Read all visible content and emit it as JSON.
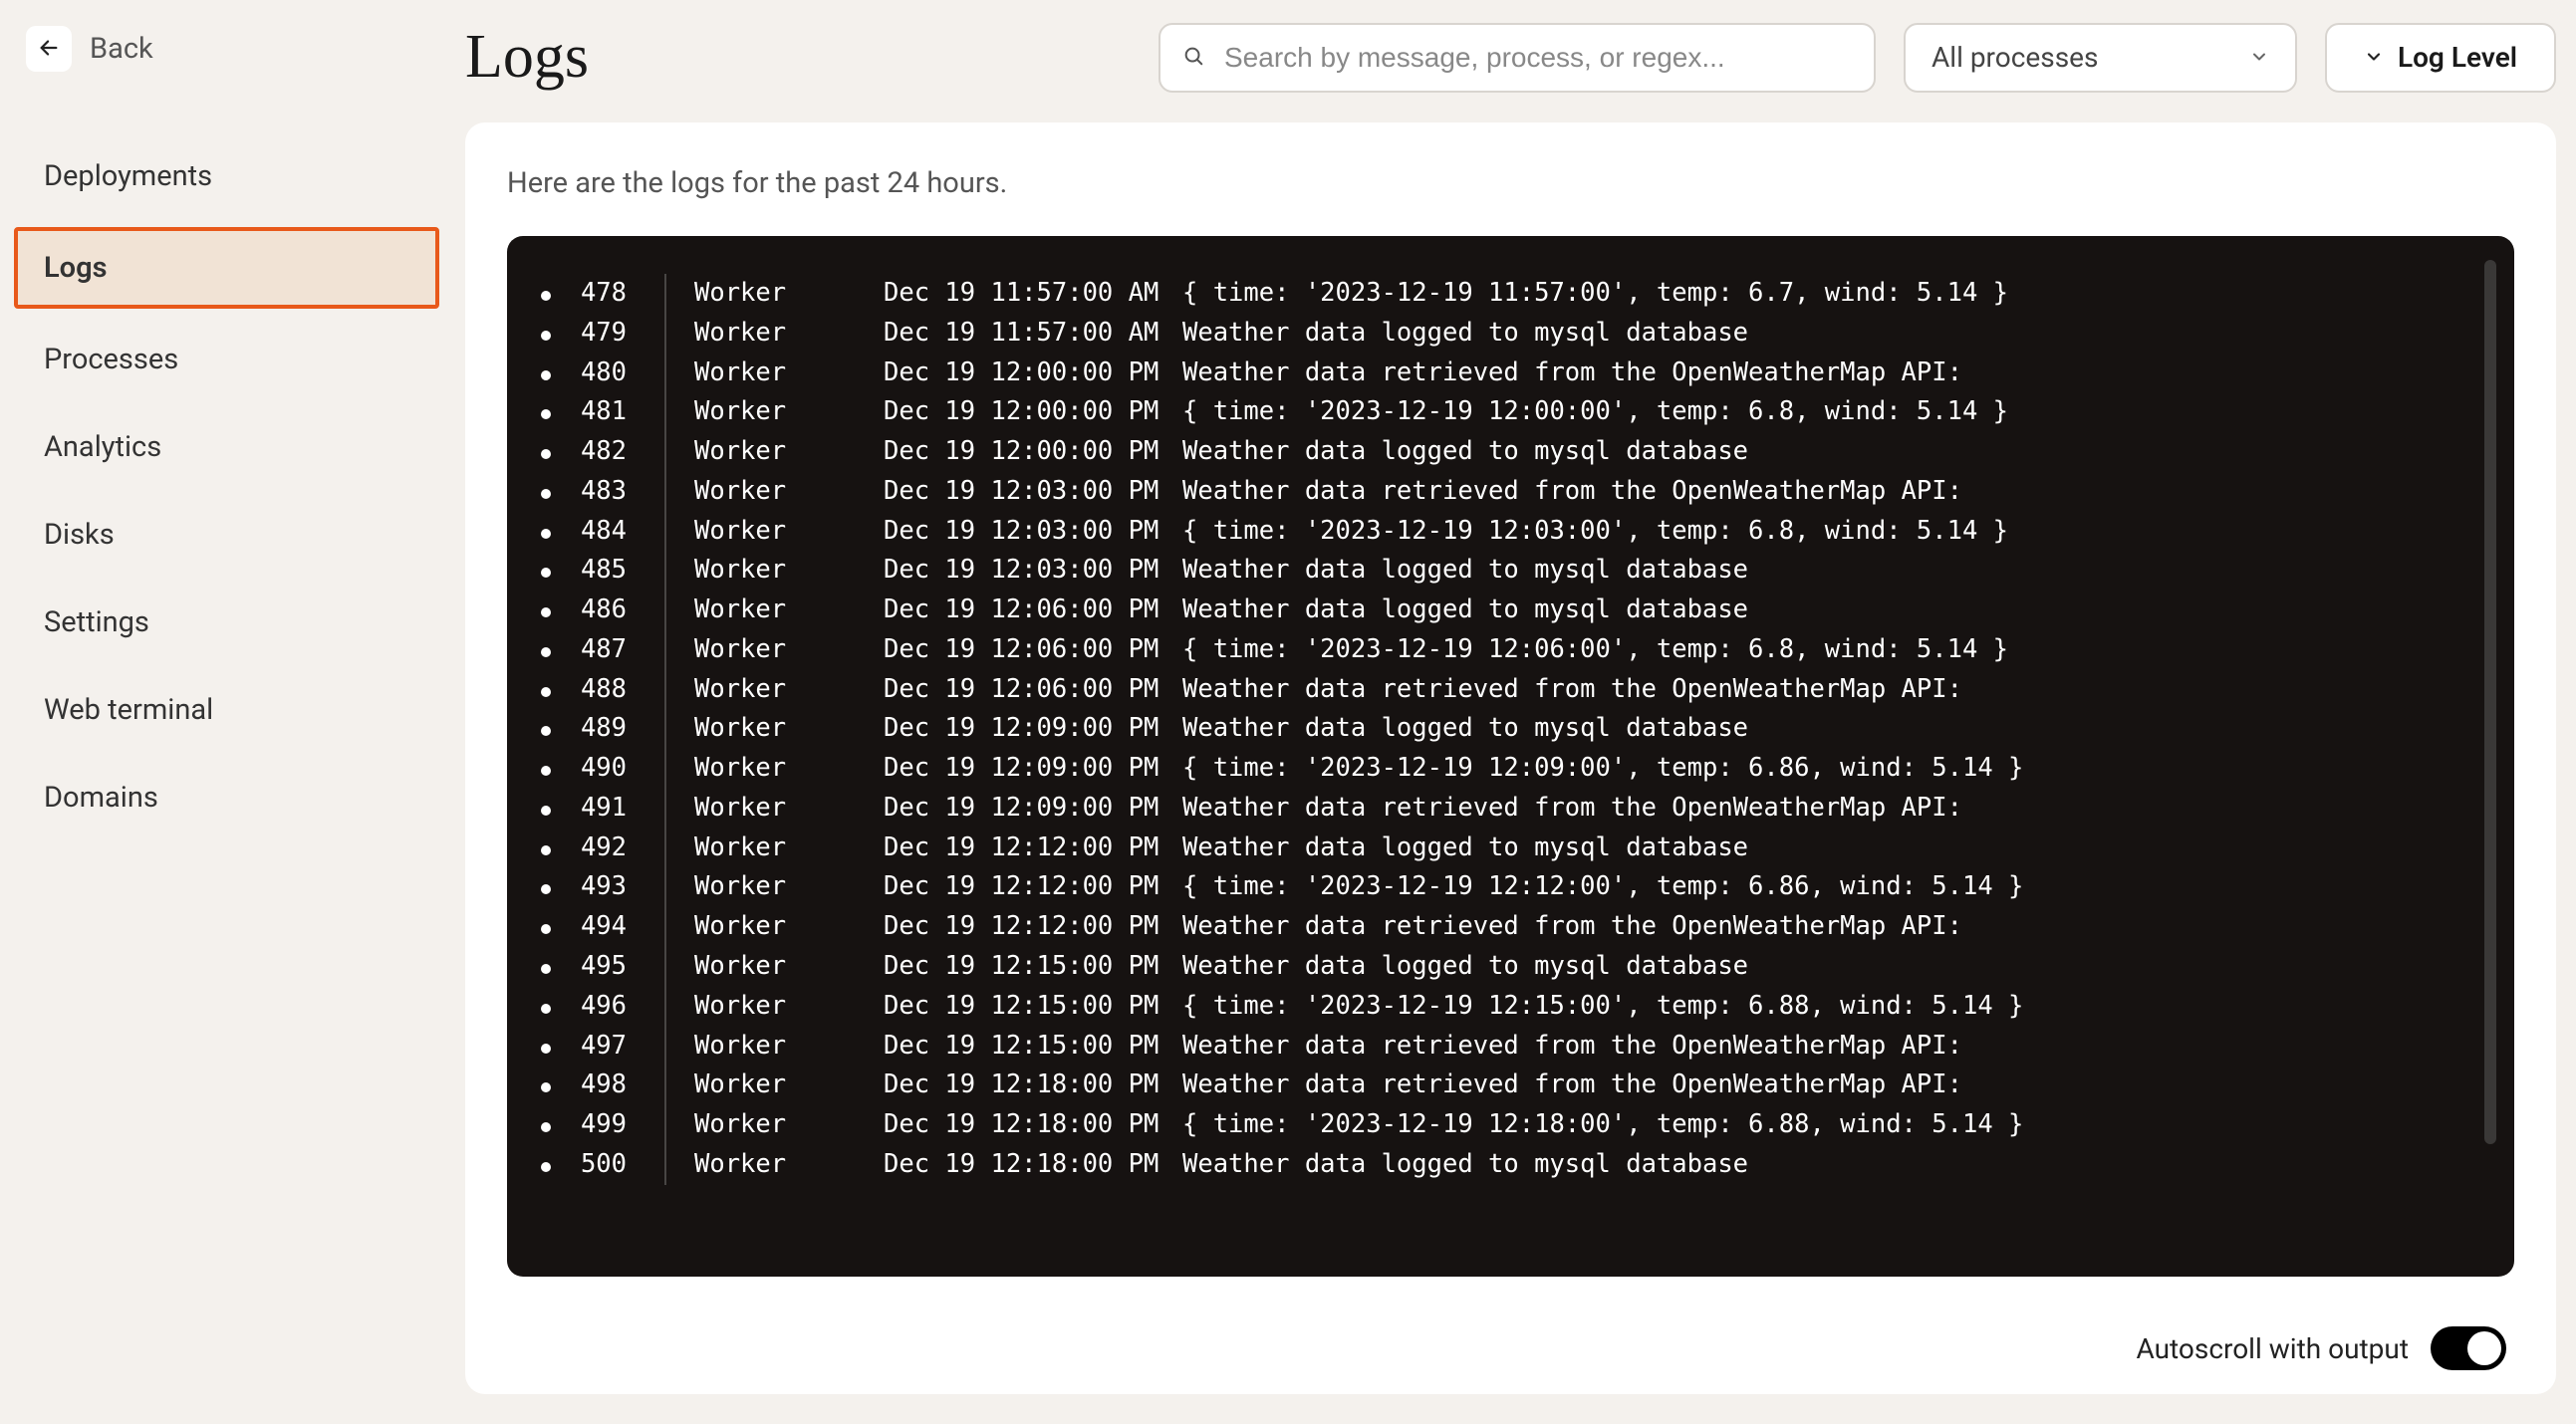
{
  "back": {
    "label": "Back"
  },
  "sidebar": {
    "items": [
      {
        "label": "Deployments",
        "active": false
      },
      {
        "label": "Logs",
        "active": true
      },
      {
        "label": "Processes",
        "active": false
      },
      {
        "label": "Analytics",
        "active": false
      },
      {
        "label": "Disks",
        "active": false
      },
      {
        "label": "Settings",
        "active": false
      },
      {
        "label": "Web terminal",
        "active": false
      },
      {
        "label": "Domains",
        "active": false
      }
    ]
  },
  "header": {
    "title": "Logs",
    "search_placeholder": "Search by message, process, or regex...",
    "process_filter": "All processes",
    "level_label": "Log Level"
  },
  "panel": {
    "note": "Here are the logs for the past 24 hours."
  },
  "footer": {
    "autoscroll_label": "Autoscroll with output",
    "autoscroll_on": true
  },
  "logs": [
    {
      "n": "478",
      "proc": "Worker",
      "ts": "Dec 19 11:57:00 AM",
      "msg": "{ time: '2023-12-19 11:57:00', temp: 6.7, wind: 5.14 }"
    },
    {
      "n": "479",
      "proc": "Worker",
      "ts": "Dec 19 11:57:00 AM",
      "msg": "Weather data logged to mysql database"
    },
    {
      "n": "480",
      "proc": "Worker",
      "ts": "Dec 19 12:00:00 PM",
      "msg": "Weather data retrieved from the OpenWeatherMap API:"
    },
    {
      "n": "481",
      "proc": "Worker",
      "ts": "Dec 19 12:00:00 PM",
      "msg": "{ time: '2023-12-19 12:00:00', temp: 6.8, wind: 5.14 }"
    },
    {
      "n": "482",
      "proc": "Worker",
      "ts": "Dec 19 12:00:00 PM",
      "msg": "Weather data logged to mysql database"
    },
    {
      "n": "483",
      "proc": "Worker",
      "ts": "Dec 19 12:03:00 PM",
      "msg": "Weather data retrieved from the OpenWeatherMap API:"
    },
    {
      "n": "484",
      "proc": "Worker",
      "ts": "Dec 19 12:03:00 PM",
      "msg": "{ time: '2023-12-19 12:03:00', temp: 6.8, wind: 5.14 }"
    },
    {
      "n": "485",
      "proc": "Worker",
      "ts": "Dec 19 12:03:00 PM",
      "msg": "Weather data logged to mysql database"
    },
    {
      "n": "486",
      "proc": "Worker",
      "ts": "Dec 19 12:06:00 PM",
      "msg": "Weather data logged to mysql database"
    },
    {
      "n": "487",
      "proc": "Worker",
      "ts": "Dec 19 12:06:00 PM",
      "msg": "{ time: '2023-12-19 12:06:00', temp: 6.8, wind: 5.14 }"
    },
    {
      "n": "488",
      "proc": "Worker",
      "ts": "Dec 19 12:06:00 PM",
      "msg": "Weather data retrieved from the OpenWeatherMap API:"
    },
    {
      "n": "489",
      "proc": "Worker",
      "ts": "Dec 19 12:09:00 PM",
      "msg": "Weather data logged to mysql database"
    },
    {
      "n": "490",
      "proc": "Worker",
      "ts": "Dec 19 12:09:00 PM",
      "msg": "{ time: '2023-12-19 12:09:00', temp: 6.86, wind: 5.14 }"
    },
    {
      "n": "491",
      "proc": "Worker",
      "ts": "Dec 19 12:09:00 PM",
      "msg": "Weather data retrieved from the OpenWeatherMap API:"
    },
    {
      "n": "492",
      "proc": "Worker",
      "ts": "Dec 19 12:12:00 PM",
      "msg": "Weather data logged to mysql database"
    },
    {
      "n": "493",
      "proc": "Worker",
      "ts": "Dec 19 12:12:00 PM",
      "msg": "{ time: '2023-12-19 12:12:00', temp: 6.86, wind: 5.14 }"
    },
    {
      "n": "494",
      "proc": "Worker",
      "ts": "Dec 19 12:12:00 PM",
      "msg": "Weather data retrieved from the OpenWeatherMap API:"
    },
    {
      "n": "495",
      "proc": "Worker",
      "ts": "Dec 19 12:15:00 PM",
      "msg": "Weather data logged to mysql database"
    },
    {
      "n": "496",
      "proc": "Worker",
      "ts": "Dec 19 12:15:00 PM",
      "msg": "{ time: '2023-12-19 12:15:00', temp: 6.88, wind: 5.14 }"
    },
    {
      "n": "497",
      "proc": "Worker",
      "ts": "Dec 19 12:15:00 PM",
      "msg": "Weather data retrieved from the OpenWeatherMap API:"
    },
    {
      "n": "498",
      "proc": "Worker",
      "ts": "Dec 19 12:18:00 PM",
      "msg": "Weather data retrieved from the OpenWeatherMap API:"
    },
    {
      "n": "499",
      "proc": "Worker",
      "ts": "Dec 19 12:18:00 PM",
      "msg": "{ time: '2023-12-19 12:18:00', temp: 6.88, wind: 5.14 }"
    },
    {
      "n": "500",
      "proc": "Worker",
      "ts": "Dec 19 12:18:00 PM",
      "msg": "Weather data logged to mysql database"
    }
  ]
}
